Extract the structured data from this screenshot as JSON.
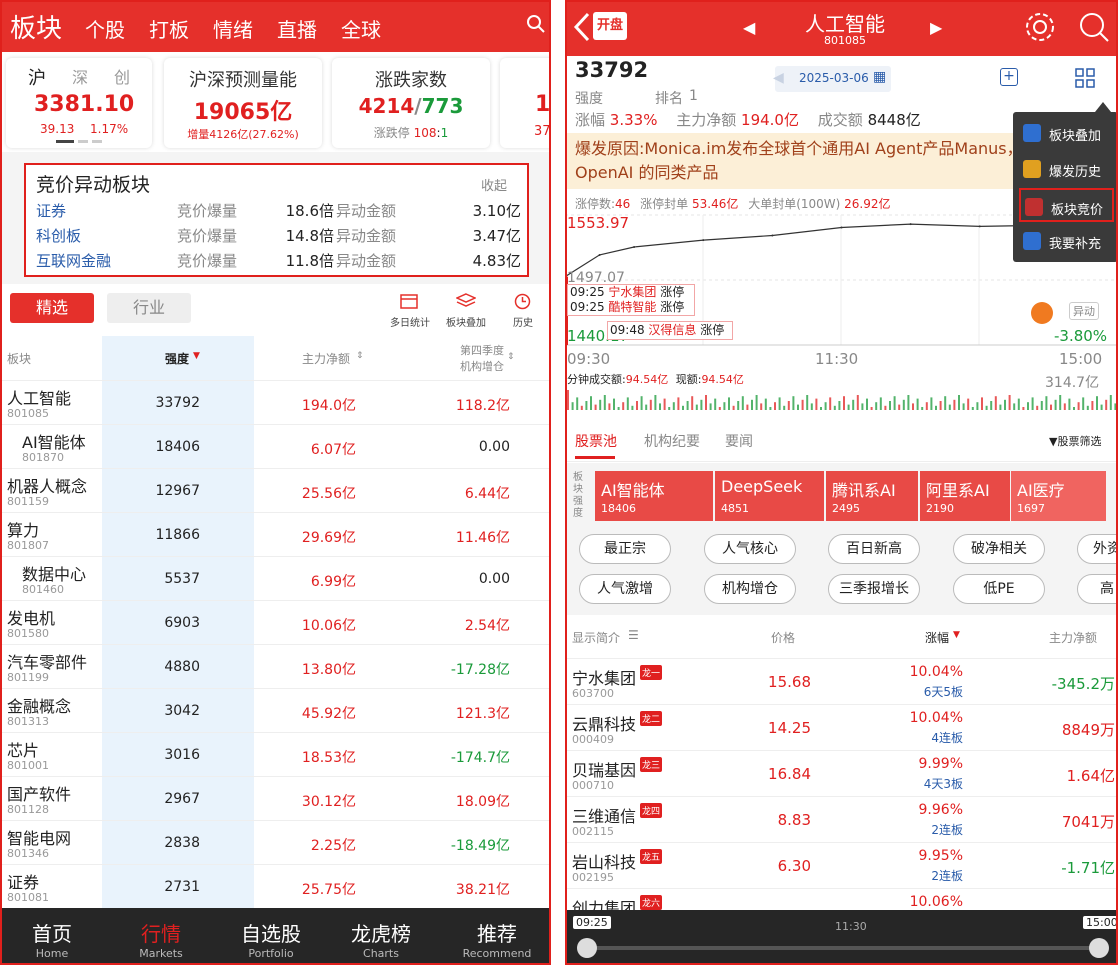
{
  "left": {
    "nav": {
      "title": "板块",
      "items": [
        "个股",
        "打板",
        "情绪",
        "直播",
        "全球"
      ]
    },
    "index_card": {
      "tabs": [
        "沪",
        "深",
        "创"
      ],
      "value": "3381.10",
      "change": "39.13",
      "pct": "1.17%"
    },
    "volume_card": {
      "title": "沪深预测量能",
      "value": "19065亿",
      "sub": "增量4126亿(27.62%)"
    },
    "updown_card": {
      "title": "涨跌家数",
      "up": "4214",
      "sep": "/",
      "down": "773",
      "sub_label": "涨跌停",
      "limit_up": "108",
      "limit_sep": ":",
      "limit_down": "1"
    },
    "peek_card": {
      "value": "1",
      "sub": "37"
    },
    "auction": {
      "title": "竞价异动板块",
      "collapse": "收起",
      "col1": "竞价爆量",
      "col2": "异动金额",
      "rows": [
        {
          "name": "证券",
          "mult": "18.6倍",
          "amt": "3.10亿"
        },
        {
          "name": "科创板",
          "mult": "14.8倍",
          "amt": "3.47亿"
        },
        {
          "name": "互联网金融",
          "mult": "11.8倍",
          "amt": "4.83亿"
        }
      ]
    },
    "tabs": {
      "selected": "精选",
      "other": "行业",
      "tools": [
        "多日统计",
        "板块叠加",
        "历史"
      ]
    },
    "table": {
      "headers": [
        "板块",
        "强度",
        "主力净额",
        "第四季度",
        "机构增仓"
      ],
      "rows": [
        {
          "name": "人工智能",
          "code": "801085",
          "strength": "33792",
          "net": "194.0亿",
          "inst": "118.2亿",
          "sub": false,
          "netc": "red",
          "instc": "red"
        },
        {
          "name": "AI智能体",
          "code": "801870",
          "strength": "18406",
          "net": "6.07亿",
          "inst": "0.00",
          "sub": true,
          "netc": "red",
          "instc": "black"
        },
        {
          "name": "机器人概念",
          "code": "801159",
          "strength": "12967",
          "net": "25.56亿",
          "inst": "6.44亿",
          "sub": false,
          "netc": "red",
          "instc": "red"
        },
        {
          "name": "算力",
          "code": "801807",
          "strength": "11866",
          "net": "29.69亿",
          "inst": "11.46亿",
          "sub": false,
          "netc": "red",
          "instc": "red"
        },
        {
          "name": "数据中心",
          "code": "801460",
          "strength": "5537",
          "net": "6.99亿",
          "inst": "0.00",
          "sub": true,
          "netc": "red",
          "instc": "black"
        },
        {
          "name": "发电机",
          "code": "801580",
          "strength": "6903",
          "net": "10.06亿",
          "inst": "2.54亿",
          "sub": false,
          "netc": "red",
          "instc": "red"
        },
        {
          "name": "汽车零部件",
          "code": "801199",
          "strength": "4880",
          "net": "13.80亿",
          "inst": "-17.28亿",
          "sub": false,
          "netc": "red",
          "instc": "green"
        },
        {
          "name": "金融概念",
          "code": "801313",
          "strength": "3042",
          "net": "45.92亿",
          "inst": "121.3亿",
          "sub": false,
          "netc": "red",
          "instc": "red"
        },
        {
          "name": "芯片",
          "code": "801001",
          "strength": "3016",
          "net": "18.53亿",
          "inst": "-174.7亿",
          "sub": false,
          "netc": "red",
          "instc": "green"
        },
        {
          "name": "国产软件",
          "code": "801128",
          "strength": "2967",
          "net": "30.12亿",
          "inst": "18.09亿",
          "sub": false,
          "netc": "red",
          "instc": "red"
        },
        {
          "name": "智能电网",
          "code": "801346",
          "strength": "2838",
          "net": "2.25亿",
          "inst": "-18.49亿",
          "sub": false,
          "netc": "red",
          "instc": "green"
        },
        {
          "name": "证券",
          "code": "801081",
          "strength": "2731",
          "net": "25.75亿",
          "inst": "38.21亿",
          "sub": false,
          "netc": "red",
          "instc": "red"
        }
      ]
    },
    "bottom": [
      {
        "cn": "首页",
        "en": "Home"
      },
      {
        "cn": "行情",
        "en": "Markets"
      },
      {
        "cn": "自选股",
        "en": "Portfolio"
      },
      {
        "cn": "龙虎榜",
        "en": "Charts"
      },
      {
        "cn": "推荐",
        "en": "Recommend"
      }
    ]
  },
  "right": {
    "nav": {
      "badge": "开盘",
      "title": "人工智能",
      "code": "801085"
    },
    "header": {
      "strength_value": "33792",
      "strength_label": "强度",
      "rank_label": "排名",
      "rank": "1",
      "date": "2025-03-06",
      "pct_label": "涨幅",
      "pct": "3.33%",
      "net_label": "主力净额",
      "net": "194.0亿",
      "vol_label": "成交额",
      "vol": "8448亿"
    },
    "reason": "爆发原因:Monica.im发布全球首个通用AI Agent产品Manus，远超 OpenAI 的同类产品",
    "stats": {
      "up_label": "涨停数:",
      "up": "46",
      "seal_label": "涨停封单",
      "seal": "53.46亿",
      "big_label": "大单封单(100W)",
      "big": "26.92亿"
    },
    "chart_data": {
      "type": "line",
      "title": "",
      "y_labels": [
        "1553.97",
        "1497.07",
        "1440.17"
      ],
      "x_labels": [
        "09:30",
        "11:30",
        "15:00"
      ],
      "ylim": [
        1440.17,
        1553.97
      ],
      "series": [
        {
          "name": "",
          "x": [
            "09:30",
            "09:45",
            "10:00",
            "10:30",
            "11:00",
            "11:30",
            "13:30",
            "14:00",
            "14:30",
            "15:00"
          ],
          "y": [
            1500,
            1519,
            1526,
            1532,
            1536,
            1543,
            1546,
            1544,
            1545,
            1545
          ]
        }
      ],
      "right_pct": "-3.80%",
      "events": [
        {
          "time": "09:25",
          "name": "宁水集团",
          "tag": "涨停"
        },
        {
          "time": "09:25",
          "name": "酷特智能",
          "tag": "涨停"
        },
        {
          "time": "09:48",
          "name": "汉得信息",
          "tag": "涨停"
        }
      ],
      "vol_line": "分钟成交额:",
      "vol_val": "94.54亿",
      "now_line": "现额:",
      "now_val": "94.54亿",
      "vol_max": "314.7亿",
      "badge": "异动"
    },
    "tabs": [
      "股票池",
      "机构纪要",
      "要闻"
    ],
    "filter": "股票筛选",
    "chip_label": "板块强度",
    "chips": [
      {
        "name": "AI智能体",
        "v": "18406"
      },
      {
        "name": "DeepSeek",
        "v": "4851"
      },
      {
        "name": "腾讯系AI",
        "v": "2495"
      },
      {
        "name": "阿里系AI",
        "v": "2190"
      },
      {
        "name": "AI医疗",
        "v": "1697"
      }
    ],
    "pills": [
      "最正宗",
      "人气核心",
      "百日新高",
      "破净相关",
      "外资",
      "人气激增",
      "机构增仓",
      "三季报增长",
      "低PE",
      "高"
    ],
    "list_headers": [
      "显示简介",
      "价格",
      "涨幅",
      "主力净额"
    ],
    "stocks": [
      {
        "name": "宁水集团",
        "code": "603700",
        "tag": "龙一",
        "price": "15.68",
        "pct": "10.04%",
        "lb": "6天5板",
        "net": "-345.2万",
        "netc": "green"
      },
      {
        "name": "云鼎科技",
        "code": "000409",
        "tag": "龙二",
        "price": "14.25",
        "pct": "10.04%",
        "lb": "4连板",
        "net": "8849万",
        "netc": "red"
      },
      {
        "name": "贝瑞基因",
        "code": "000710",
        "tag": "龙三",
        "price": "16.84",
        "pct": "9.99%",
        "lb": "4天3板",
        "net": "1.64亿",
        "netc": "red"
      },
      {
        "name": "三维通信",
        "code": "002115",
        "tag": "龙四",
        "price": "8.83",
        "pct": "9.96%",
        "lb": "2连板",
        "net": "7041万",
        "netc": "red"
      },
      {
        "name": "岩山科技",
        "code": "002195",
        "tag": "龙五",
        "price": "6.30",
        "pct": "9.95%",
        "lb": "2连板",
        "net": "-1.71亿",
        "netc": "green"
      },
      {
        "name": "创力集团",
        "code": "",
        "tag": "龙六",
        "price": "",
        "pct": "10.06%",
        "lb": "",
        "net": "",
        "netc": "red"
      }
    ],
    "menu": [
      "板块叠加",
      "爆发历史",
      "板块竞价",
      "我要补充"
    ],
    "timeline": {
      "start": "09:25",
      "mid": "11:30",
      "end": "15:00"
    }
  }
}
